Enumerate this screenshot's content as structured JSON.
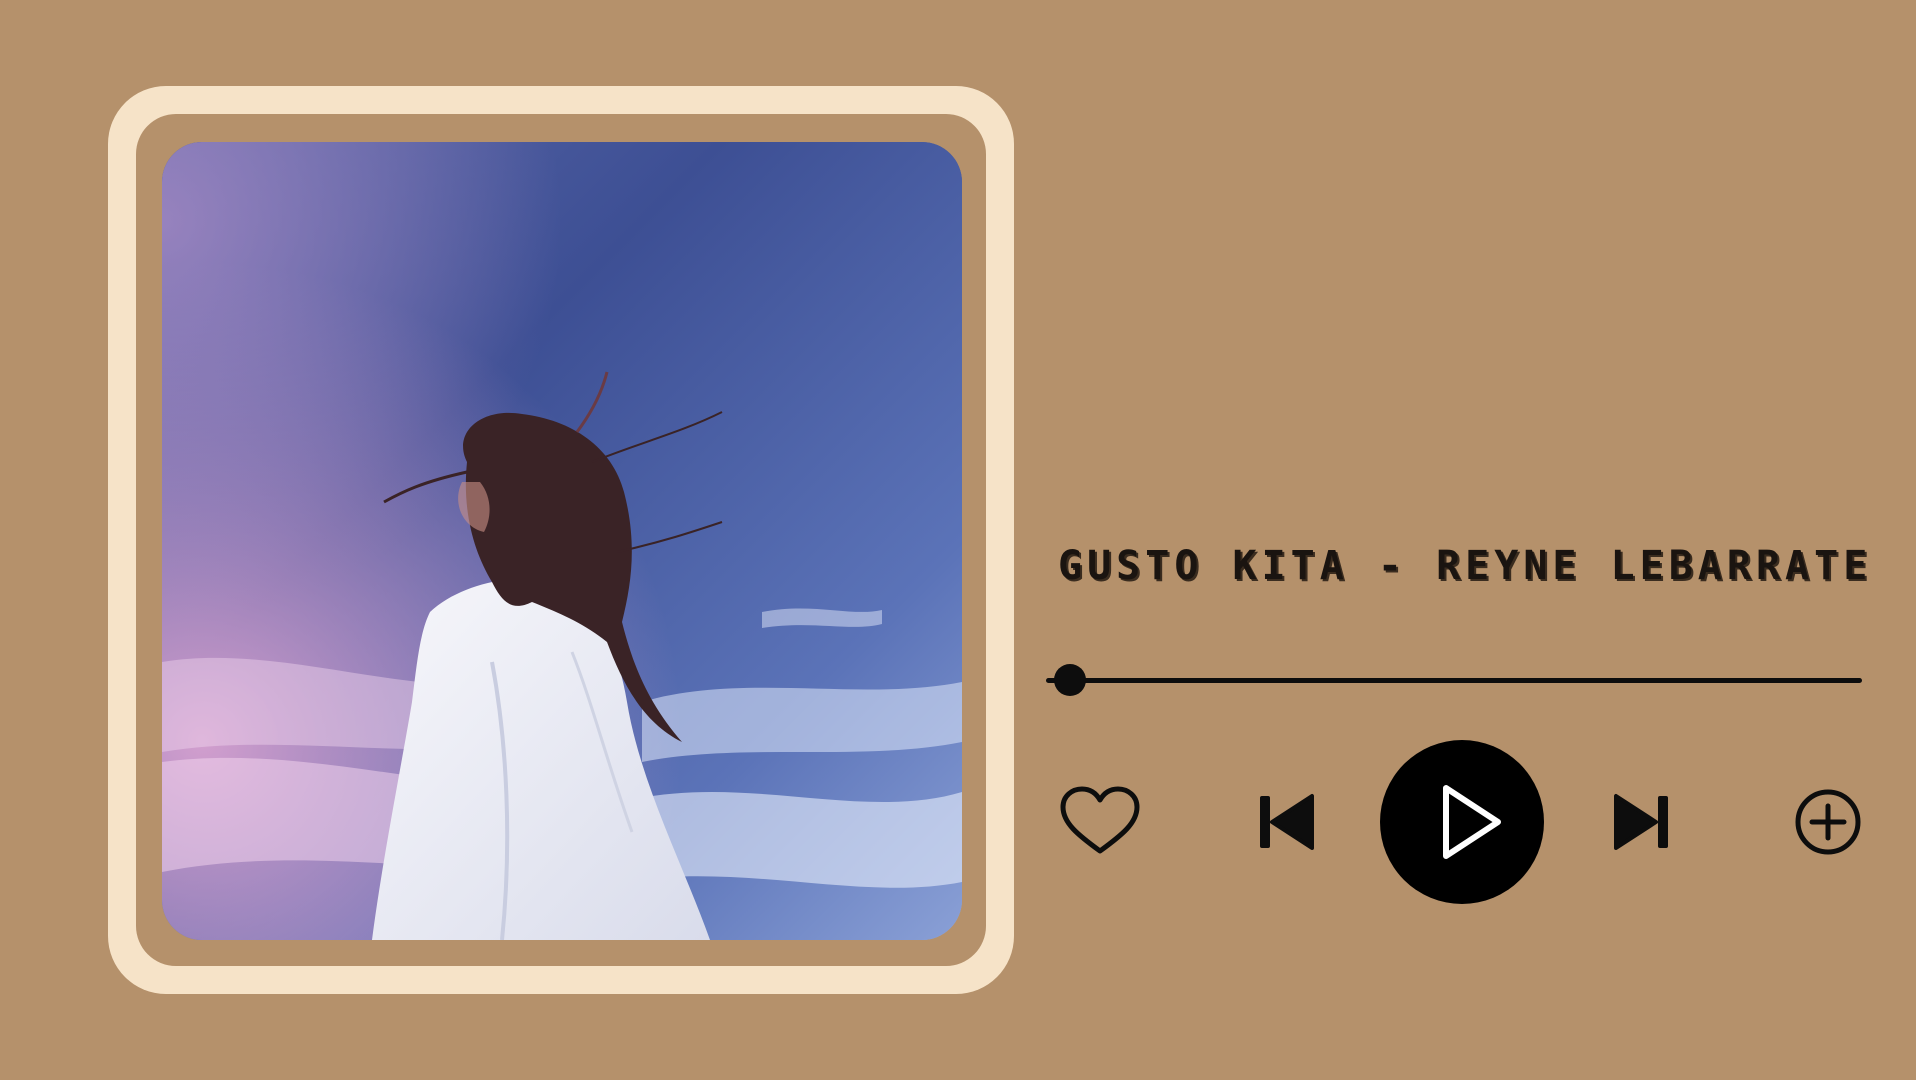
{
  "player": {
    "track_title": "GUSTO KITA - REYNE LEBARRATE",
    "progress": 0.03
  },
  "controls": {
    "like_icon": "heart-outline-icon",
    "previous_icon": "skip-previous-icon",
    "play_icon": "play-icon",
    "next_icon": "skip-next-icon",
    "add_icon": "plus-circle-icon"
  },
  "colors": {
    "background": "#b5916b",
    "frame": "#f6e3c8",
    "controls": "#000000"
  }
}
